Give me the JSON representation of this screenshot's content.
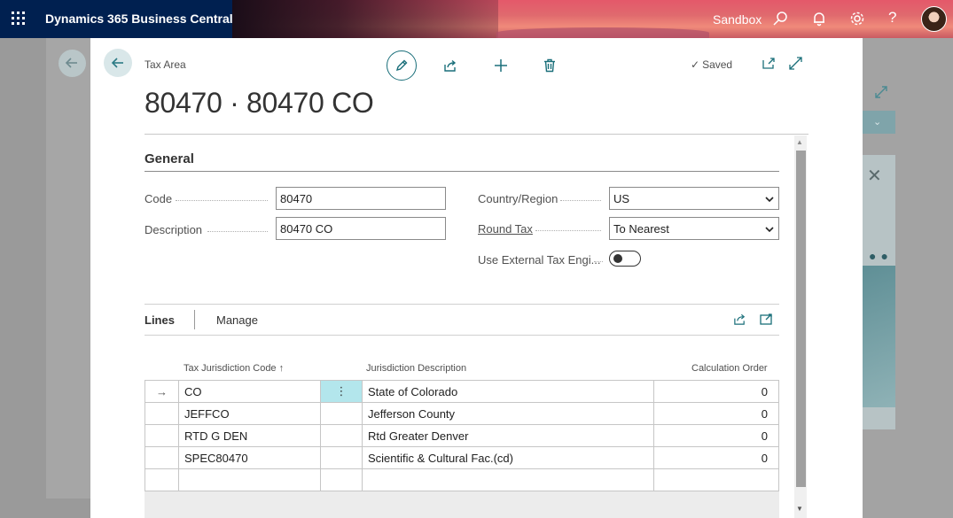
{
  "topbar": {
    "app_title": "Dynamics 365 Business Central",
    "environment": "Sandbox",
    "icons": [
      "app-launcher-icon",
      "search-icon",
      "bell-icon",
      "gear-icon",
      "help-icon"
    ]
  },
  "dialog": {
    "breadcrumb": "Tax Area",
    "status": "Saved",
    "title": "80470 · 80470 CO",
    "actions": [
      "edit-icon",
      "share-icon",
      "new-icon",
      "delete-icon"
    ]
  },
  "general": {
    "section_title": "General",
    "code_label": "Code",
    "code_value": "80470",
    "description_label": "Description",
    "description_value": "80470 CO",
    "country_label": "Country/Region",
    "country_value": "US",
    "round_tax_label": "Round Tax",
    "round_tax_value": "To Nearest",
    "external_engine_label": "Use External Tax Engi...",
    "external_engine_on": false
  },
  "lines": {
    "label": "Lines",
    "manage_label": "Manage",
    "columns": {
      "code": "Tax Jurisdiction Code ↑",
      "description": "Jurisdiction Description",
      "order": "Calculation Order"
    },
    "rows": [
      {
        "code": "CO",
        "description": "State of Colorado",
        "order": "0"
      },
      {
        "code": "JEFFCO",
        "description": "Jefferson County",
        "order": "0"
      },
      {
        "code": "RTD G DEN",
        "description": "Rtd Greater Denver",
        "order": "0"
      },
      {
        "code": "SPEC80470",
        "description": "Scientific & Cultural Fac.(cd)",
        "order": "0"
      }
    ],
    "selected_marker": "→",
    "row_menu": "⋮"
  },
  "colors": {
    "accent": "#1a6f7a",
    "topbar": "#002050"
  }
}
